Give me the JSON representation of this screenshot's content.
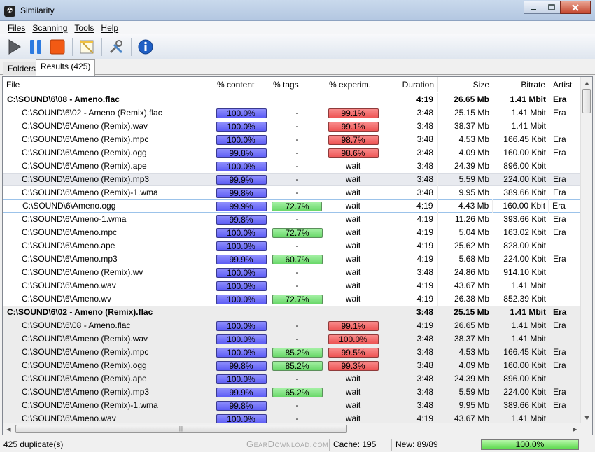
{
  "window": {
    "title": "Similarity",
    "app_icon_glyph": "☢"
  },
  "menu": [
    "Files",
    "Scanning",
    "Tools",
    "Help"
  ],
  "toolbar": {
    "icons": [
      "play-icon",
      "pause-icon",
      "stop-icon",
      "options-icon",
      "tools-icon",
      "info-icon"
    ]
  },
  "tabs": [
    {
      "label": "Folders",
      "active": false
    },
    {
      "label": "Results (425)",
      "active": true
    }
  ],
  "columns": [
    "File",
    "% content",
    "% tags",
    "% experim.",
    "Duration",
    "Size",
    "Bitrate",
    "Artist"
  ],
  "rows": [
    {
      "group": true,
      "file": "C:\\SOUND\\6\\08 - Ameno.flac",
      "content": "",
      "tags": "",
      "exp": "",
      "duration": "4:19",
      "size": "26.65 Mb",
      "bitrate": "1.41 Mbit",
      "artist": "Era"
    },
    {
      "file": "C:\\SOUND\\6\\02 - Ameno (Remix).flac",
      "content": "100.0%",
      "tags": "-",
      "exp": "99.1%",
      "exp_kind": "red",
      "duration": "3:48",
      "size": "25.15 Mb",
      "bitrate": "1.41 Mbit",
      "artist": "Era"
    },
    {
      "file": "C:\\SOUND\\6\\Ameno (Remix).wav",
      "content": "100.0%",
      "tags": "-",
      "exp": "99.1%",
      "exp_kind": "red",
      "duration": "3:48",
      "size": "38.37 Mb",
      "bitrate": "1.41 Mbit",
      "artist": ""
    },
    {
      "file": "C:\\SOUND\\6\\Ameno (Remix).mpc",
      "content": "100.0%",
      "tags": "-",
      "exp": "98.7%",
      "exp_kind": "red",
      "duration": "3:48",
      "size": "4.53 Mb",
      "bitrate": "166.45 Kbit",
      "artist": "Era"
    },
    {
      "file": "C:\\SOUND\\6\\Ameno (Remix).ogg",
      "content": "99.8%",
      "tags": "-",
      "exp": "98.6%",
      "exp_kind": "red",
      "duration": "3:48",
      "size": "4.09 Mb",
      "bitrate": "160.00 Kbit",
      "artist": "Era"
    },
    {
      "file": "C:\\SOUND\\6\\Ameno (Remix).ape",
      "content": "100.0%",
      "tags": "-",
      "exp": "wait",
      "duration": "3:48",
      "size": "24.39 Mb",
      "bitrate": "896.00 Kbit",
      "artist": ""
    },
    {
      "file": "C:\\SOUND\\6\\Ameno (Remix).mp3",
      "content": "99.9%",
      "tags": "-",
      "exp": "wait",
      "duration": "3:48",
      "size": "5.59 Mb",
      "bitrate": "224.00 Kbit",
      "artist": "Era",
      "style": "hl"
    },
    {
      "file": "C:\\SOUND\\6\\Ameno (Remix)-1.wma",
      "content": "99.8%",
      "tags": "-",
      "exp": "wait",
      "duration": "3:48",
      "size": "9.95 Mb",
      "bitrate": "389.66 Kbit",
      "artist": "Era"
    },
    {
      "file": "C:\\SOUND\\6\\Ameno.ogg",
      "content": "99.9%",
      "tags": "72.7%",
      "tags_kind": "green",
      "exp": "wait",
      "duration": "4:19",
      "size": "4.43 Mb",
      "bitrate": "160.00 Kbit",
      "artist": "Era",
      "style": "sel"
    },
    {
      "file": "C:\\SOUND\\6\\Ameno-1.wma",
      "content": "99.8%",
      "tags": "-",
      "exp": "wait",
      "duration": "4:19",
      "size": "11.26 Mb",
      "bitrate": "393.66 Kbit",
      "artist": "Era"
    },
    {
      "file": "C:\\SOUND\\6\\Ameno.mpc",
      "content": "100.0%",
      "tags": "72.7%",
      "tags_kind": "green",
      "exp": "wait",
      "duration": "4:19",
      "size": "5.04 Mb",
      "bitrate": "163.02 Kbit",
      "artist": "Era"
    },
    {
      "file": "C:\\SOUND\\6\\Ameno.ape",
      "content": "100.0%",
      "tags": "-",
      "exp": "wait",
      "duration": "4:19",
      "size": "25.62 Mb",
      "bitrate": "828.00 Kbit",
      "artist": ""
    },
    {
      "file": "C:\\SOUND\\6\\Ameno.mp3",
      "content": "99.9%",
      "tags": "60.7%",
      "tags_kind": "green",
      "exp": "wait",
      "duration": "4:19",
      "size": "5.68 Mb",
      "bitrate": "224.00 Kbit",
      "artist": "Era"
    },
    {
      "file": "C:\\SOUND\\6\\Ameno (Remix).wv",
      "content": "100.0%",
      "tags": "-",
      "exp": "wait",
      "duration": "3:48",
      "size": "24.86 Mb",
      "bitrate": "914.10 Kbit",
      "artist": ""
    },
    {
      "file": "C:\\SOUND\\6\\Ameno.wav",
      "content": "100.0%",
      "tags": "-",
      "exp": "wait",
      "duration": "4:19",
      "size": "43.67 Mb",
      "bitrate": "1.41 Mbit",
      "artist": ""
    },
    {
      "file": "C:\\SOUND\\6\\Ameno.wv",
      "content": "100.0%",
      "tags": "72.7%",
      "tags_kind": "green",
      "exp": "wait",
      "duration": "4:19",
      "size": "26.38 Mb",
      "bitrate": "852.39 Kbit",
      "artist": ""
    },
    {
      "group": true,
      "zone": true,
      "file": "C:\\SOUND\\6\\02 - Ameno (Remix).flac",
      "content": "",
      "tags": "",
      "exp": "",
      "duration": "3:48",
      "size": "25.15 Mb",
      "bitrate": "1.41 Mbit",
      "artist": "Era"
    },
    {
      "zone": true,
      "file": "C:\\SOUND\\6\\08 - Ameno.flac",
      "content": "100.0%",
      "tags": "-",
      "exp": "99.1%",
      "exp_kind": "red",
      "duration": "4:19",
      "size": "26.65 Mb",
      "bitrate": "1.41 Mbit",
      "artist": "Era"
    },
    {
      "zone": true,
      "file": "C:\\SOUND\\6\\Ameno (Remix).wav",
      "content": "100.0%",
      "tags": "-",
      "exp": "100.0%",
      "exp_kind": "red",
      "duration": "3:48",
      "size": "38.37 Mb",
      "bitrate": "1.41 Mbit",
      "artist": ""
    },
    {
      "zone": true,
      "file": "C:\\SOUND\\6\\Ameno (Remix).mpc",
      "content": "100.0%",
      "tags": "85.2%",
      "tags_kind": "green",
      "exp": "99.5%",
      "exp_kind": "red",
      "duration": "3:48",
      "size": "4.53 Mb",
      "bitrate": "166.45 Kbit",
      "artist": "Era"
    },
    {
      "zone": true,
      "file": "C:\\SOUND\\6\\Ameno (Remix).ogg",
      "content": "99.8%",
      "tags": "85.2%",
      "tags_kind": "green",
      "exp": "99.3%",
      "exp_kind": "red",
      "duration": "3:48",
      "size": "4.09 Mb",
      "bitrate": "160.00 Kbit",
      "artist": "Era"
    },
    {
      "zone": true,
      "file": "C:\\SOUND\\6\\Ameno (Remix).ape",
      "content": "100.0%",
      "tags": "-",
      "exp": "wait",
      "duration": "3:48",
      "size": "24.39 Mb",
      "bitrate": "896.00 Kbit",
      "artist": ""
    },
    {
      "zone": true,
      "file": "C:\\SOUND\\6\\Ameno (Remix).mp3",
      "content": "99.9%",
      "tags": "65.2%",
      "tags_kind": "green",
      "exp": "wait",
      "duration": "3:48",
      "size": "5.59 Mb",
      "bitrate": "224.00 Kbit",
      "artist": "Era"
    },
    {
      "zone": true,
      "file": "C:\\SOUND\\6\\Ameno (Remix)-1.wma",
      "content": "99.8%",
      "tags": "-",
      "exp": "wait",
      "duration": "3:48",
      "size": "9.95 Mb",
      "bitrate": "389.66 Kbit",
      "artist": "Era"
    },
    {
      "zone": true,
      "file": "C:\\SOUND\\6\\Ameno.wav",
      "content": "100.0%",
      "tags": "-",
      "exp": "wait",
      "duration": "4:19",
      "size": "43.67 Mb",
      "bitrate": "1.41 Mbit",
      "artist": ""
    }
  ],
  "status": {
    "duplicates": "425 duplicate(s)",
    "cache": "Cache: 195",
    "new": "New: 89/89",
    "progress": "100.0%",
    "progress_value": 1.0
  },
  "watermark": "GearDownload.com",
  "colors": {
    "content_bar": "#6a6af7",
    "tags_bar": "#7fe07f",
    "exp_bar": "#f06060",
    "progress_bar": "#59d84a"
  }
}
